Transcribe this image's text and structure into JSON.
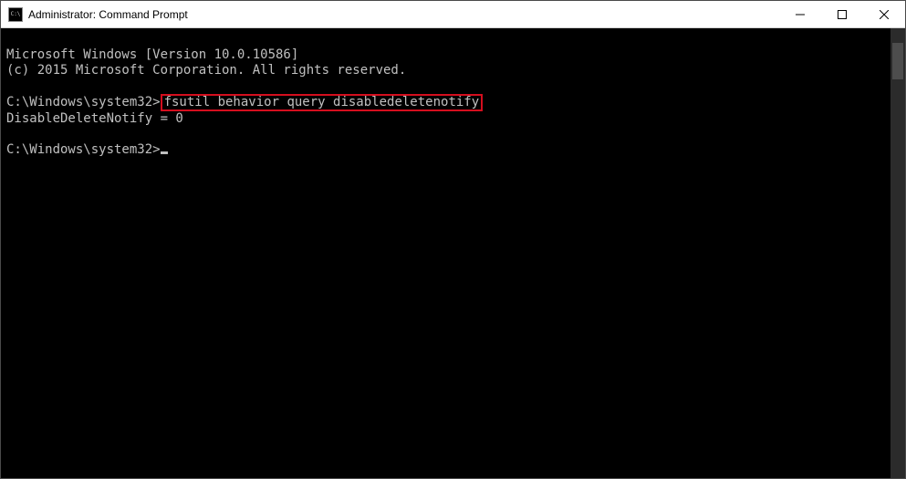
{
  "window": {
    "title": "Administrator: Command Prompt",
    "icon_label": "C:\\"
  },
  "console": {
    "header1": "Microsoft Windows [Version 10.0.10586]",
    "header2": "(c) 2015 Microsoft Corporation. All rights reserved.",
    "prompt1_prefix": "C:\\Windows\\system32>",
    "prompt1_cmd": "fsutil behavior query disabledeletenotify",
    "output1": "DisableDeleteNotify = 0",
    "prompt2_prefix": "C:\\Windows\\system32>"
  }
}
